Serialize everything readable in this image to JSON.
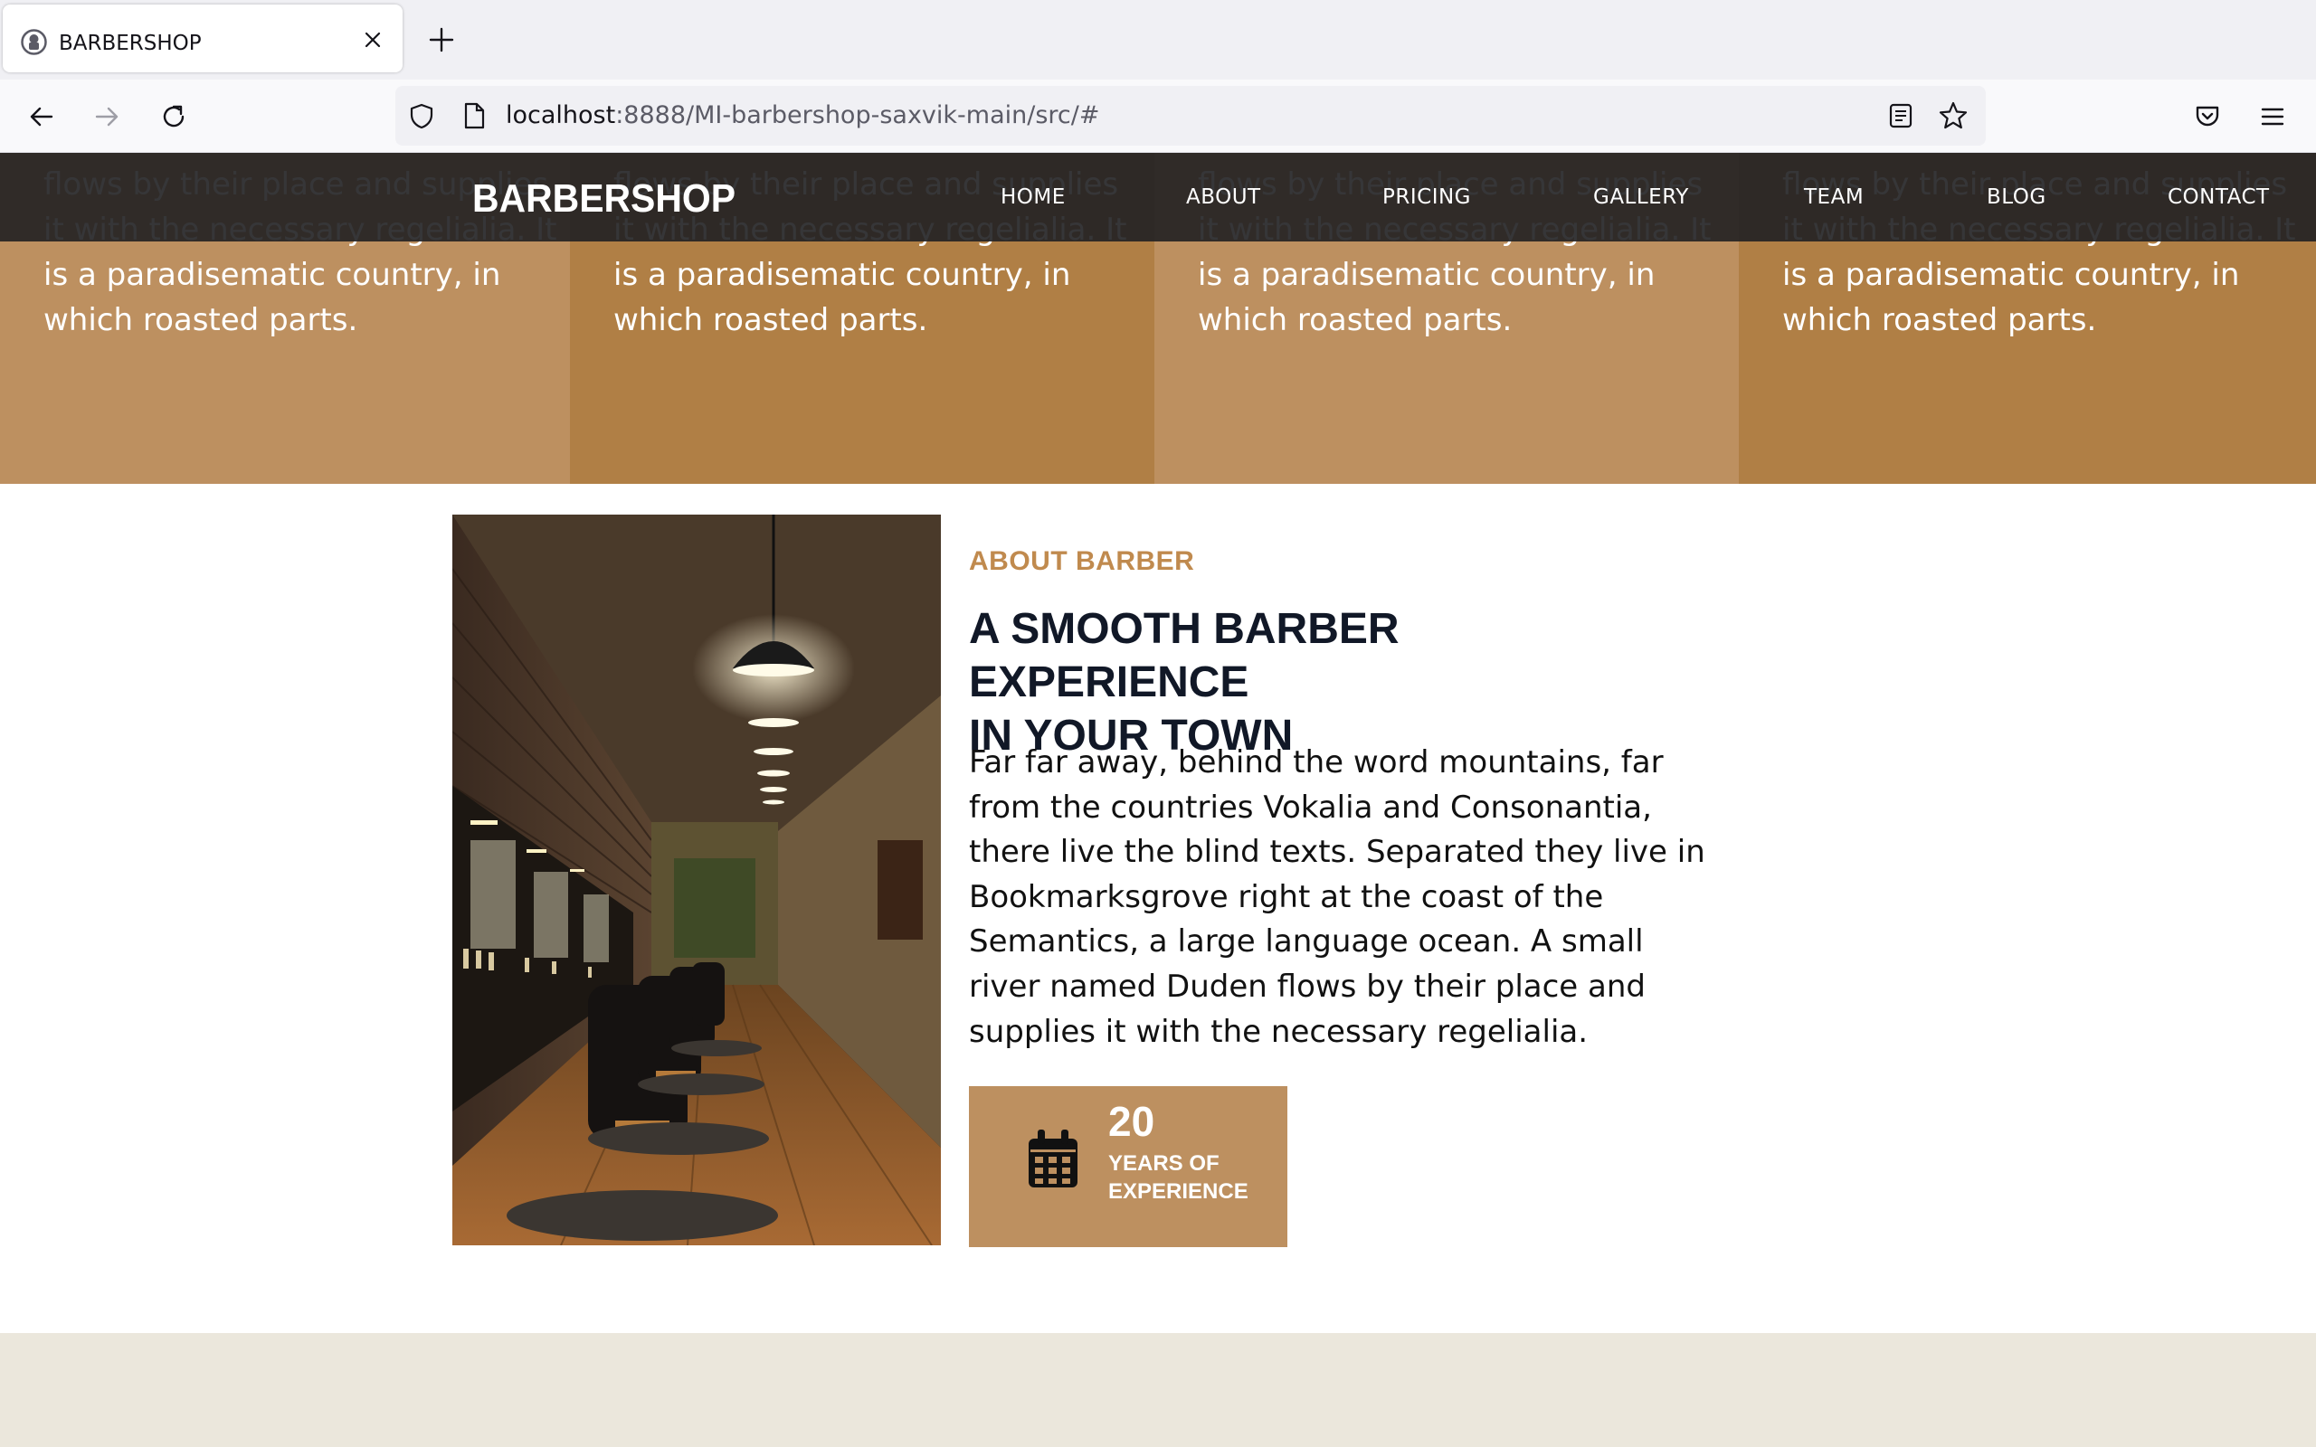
{
  "browser": {
    "tab": {
      "title": "BARBERSHOP"
    },
    "url": {
      "host": "localhost",
      "path": ":8888/MI-barbershop-saxvik-main/src/#"
    }
  },
  "site": {
    "brand": "BARBERSHOP",
    "menu": [
      {
        "label": "HOME"
      },
      {
        "label": "ABOUT"
      },
      {
        "label": "PRICING"
      },
      {
        "label": "GALLERY"
      },
      {
        "label": "TEAM"
      },
      {
        "label": "BLOG"
      },
      {
        "label": "CONTACT"
      }
    ],
    "services": [
      {
        "text": "flows by their place and supplies it with the necessary regelialia. It is a paradisematic country, in which roasted parts."
      },
      {
        "text": "flows by their place and supplies it with the necessary regelialia. It is a paradisematic country, in which roasted parts."
      },
      {
        "text": "flows by their place and supplies it with the necessary regelialia. It is a paradisematic country, in which roasted parts."
      },
      {
        "text": "flows by their place and supplies it with the necessary regelialia. It is a paradisematic country, in which roasted parts."
      }
    ],
    "about": {
      "eyebrow": "ABOUT BARBER",
      "title_line1": "A SMOOTH BARBER EXPERIENCE",
      "title_line2": "IN YOUR TOWN",
      "body": "Far far away, behind the word mountains, far from the countries Vokalia and Consonantia, there live the blind texts. Separated they live in Bookmarksgrove right at the coast of the Semantics, a large language ocean. A small river named Duden flows by their place and supplies it with the necessary regelialia.",
      "experience": {
        "number": "20",
        "label": "YEARS OF EXPERIENCE"
      }
    }
  },
  "colors": {
    "accent_light": "#bd9060",
    "accent_dark": "#b07f45",
    "eyebrow": "#c08a4e",
    "header_bg": "#202022",
    "beige": "#ebe7dc"
  }
}
